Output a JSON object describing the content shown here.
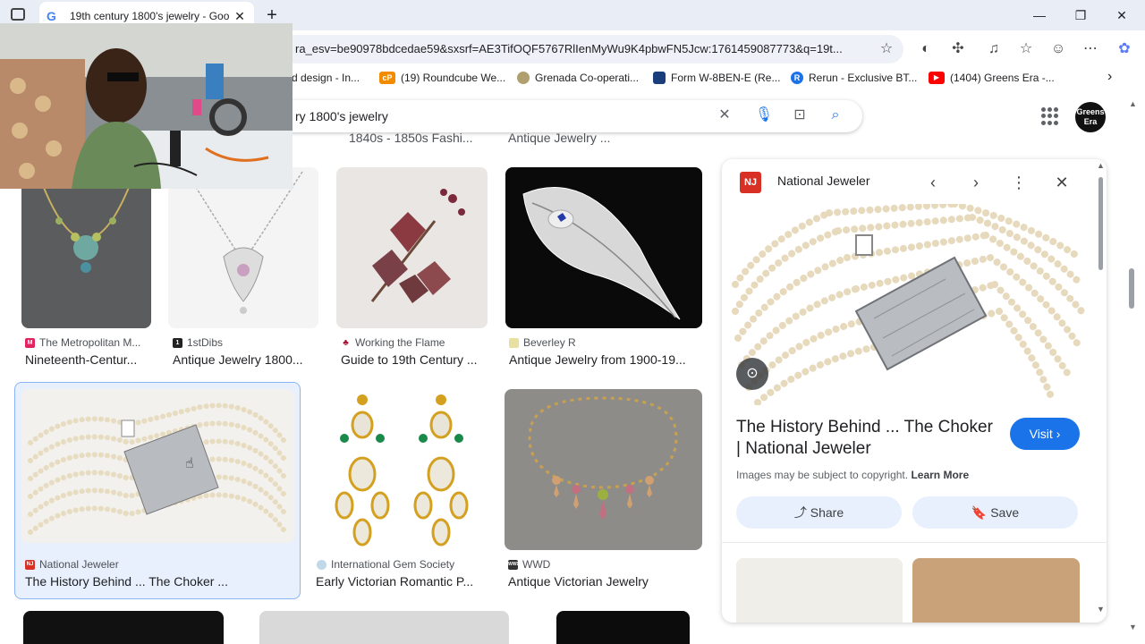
{
  "tab": {
    "title": "19th century 1800's jewelry - Goo",
    "favicon": "G"
  },
  "window": {
    "minimize": "—",
    "restore": "❐",
    "close": "✕",
    "new_tab": "+"
  },
  "address": {
    "url": "ra_esv=be90978bdcedae59&sxsrf=AE3TifOQF5767RlIenMyWu9K4pbwFN5Jcw:1761459087773&q=19t..."
  },
  "bookmarks": [
    {
      "label": "d design - In...",
      "color": "#888888",
      "glyph": ""
    },
    {
      "label": "(19) Roundcube We...",
      "color": "#f28b00",
      "glyph": "cP"
    },
    {
      "label": "Grenada Co-operati...",
      "color": "#b0a070",
      "glyph": ""
    },
    {
      "label": "Form W-8BEN-E (Re...",
      "color": "#1a3d7c",
      "glyph": ""
    },
    {
      "label": "Rerun - Exclusive BT...",
      "color": "#1a73e8",
      "glyph": "R"
    },
    {
      "label": "(1404) Greens Era -...",
      "color": "#ff0000",
      "glyph": "▶"
    }
  ],
  "search": {
    "query": "ry 1800's jewelry"
  },
  "account": {
    "avatar_text": "Greens Era"
  },
  "top_captions": [
    "1840s - 1850s Fashi...",
    "Antique Jewelry ..."
  ],
  "results": [
    {
      "source": "The Metropolitan M...",
      "title": "Nineteenth-Centur...",
      "fav_color": "#e0245e",
      "fav": "M"
    },
    {
      "source": "1stDibs",
      "title": "Antique Jewelry 1800...",
      "fav_color": "#222222",
      "fav": "1"
    },
    {
      "source": "Working the Flame",
      "title": "Guide to 19th Century ...",
      "fav_color": "#a01030",
      "fav": "♣"
    },
    {
      "source": "Beverley R",
      "title": "Antique Jewelry from 1900-19...",
      "fav_color": "#e8e0a0",
      "fav": ""
    },
    {
      "source": "National Jeweler",
      "title": "The History Behind ... The Choker ...",
      "fav_color": "#d93025",
      "fav": "NJ"
    },
    {
      "source": "International Gem Society",
      "title": "Early Victorian Romantic P...",
      "fav_color": "#c0d8e8",
      "fav": ""
    },
    {
      "source": "WWD",
      "title": "Antique Victorian Jewelry",
      "fav_color": "#333333",
      "fav": "WWD"
    }
  ],
  "panel": {
    "logo": "NJ",
    "source": "National Jeweler",
    "title": "The History Behind ... The Choker | National Jeweler",
    "visit": "Visit",
    "copyright": "Images may be subject to copyright.",
    "learn_more": "Learn More",
    "share": "Share",
    "save": "Save"
  }
}
